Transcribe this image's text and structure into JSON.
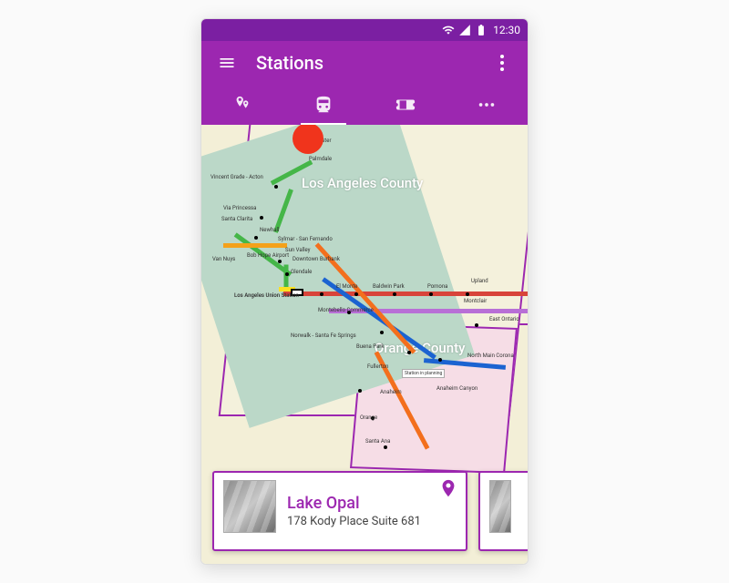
{
  "statusbar": {
    "time": "12:30"
  },
  "appbar": {
    "title": "Stations"
  },
  "tabs": {
    "active_index": 1
  },
  "map": {
    "counties": {
      "la": "Los Angeles County",
      "oc": "Orange County"
    },
    "stations": {
      "lancaster": "Lancaster",
      "palmdale": "Palmdale",
      "vincent": "Vincent Grade - Acton",
      "princessa": "Via Princessa",
      "santa_clarita": "Santa Clarita",
      "newhall": "Newhall",
      "sylmar": "Sylmar - San Fernando",
      "sun_valley": "Sun Valley",
      "bob_hope": "Bob Hope Airport",
      "burbank": "Downtown Burbank",
      "glendale": "Glendale",
      "van_nuys": "Van Nuys",
      "union": "Los Angeles Union Station",
      "elmonte": "El Monte",
      "baldwin": "Baldwin Park",
      "pomona": "Pomona",
      "upland": "Upland",
      "montclair": "Montclair",
      "montebello": "Montebello Commerce",
      "norwalk": "Norwalk - Santa Fe Springs",
      "buena_park": "Buena Park",
      "fullerton": "Fullerton",
      "anaheim": "Anaheim",
      "anaheim_canyon": "Anaheim Canyon",
      "orange": "Orange",
      "santa_ana": "Santa Ana",
      "north_main": "North Main Corona",
      "east_ontario": "East Ontario",
      "station_planning": "Station in planning"
    }
  },
  "cards": {
    "current": {
      "name": "Lake Opal",
      "address": "178 Kody Place Suite 681"
    }
  },
  "colors": {
    "primary": "#9C27B0",
    "primary_dark": "#7B1FA2",
    "finger": "#F0341C"
  }
}
